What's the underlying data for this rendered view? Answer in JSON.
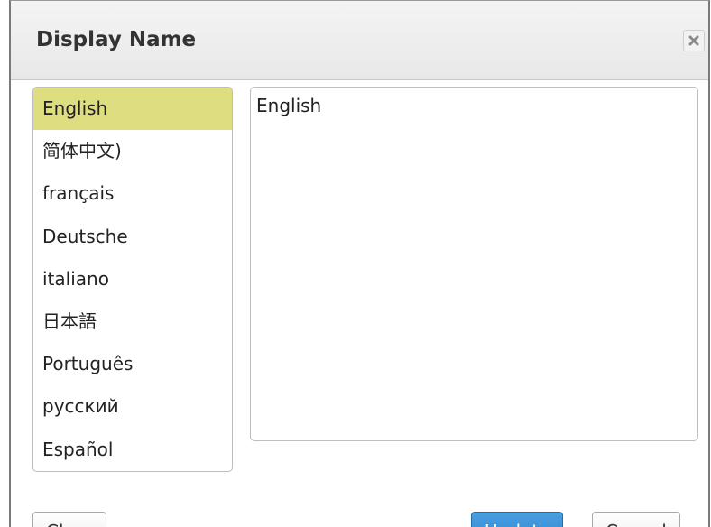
{
  "dialog": {
    "title": "Display Name",
    "close_glyph": "✖"
  },
  "languages": [
    {
      "label": "English",
      "selected": true
    },
    {
      "label": "简体中文)",
      "selected": false
    },
    {
      "label": "français",
      "selected": false
    },
    {
      "label": "Deutsche",
      "selected": false
    },
    {
      "label": "italiano",
      "selected": false
    },
    {
      "label": "日本語",
      "selected": false
    },
    {
      "label": "Português",
      "selected": false
    },
    {
      "label": "русский",
      "selected": false
    },
    {
      "label": "Español",
      "selected": false
    }
  ],
  "name_field": {
    "value": "English"
  },
  "buttons": {
    "clear": "Clear",
    "update": "Update",
    "cancel": "Cancel"
  },
  "colors": {
    "selected_item": "#dede80",
    "primary_button": "#2a82cc"
  }
}
